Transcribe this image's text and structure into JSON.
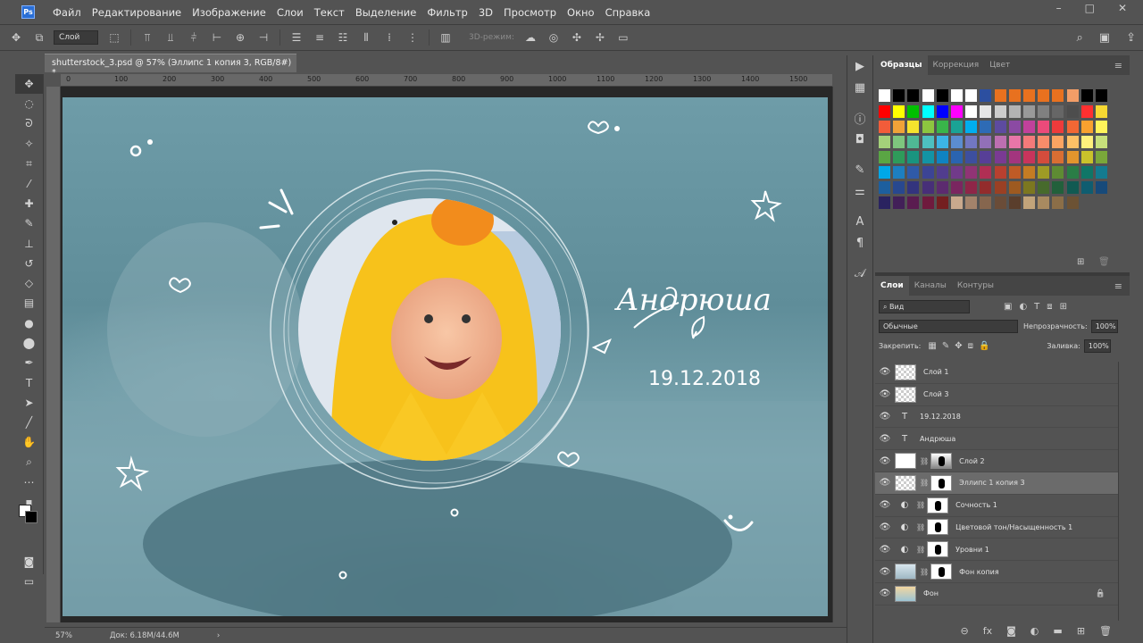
{
  "app": {
    "logo": "Ps"
  },
  "menu": [
    "Файл",
    "Редактирование",
    "Изображение",
    "Слои",
    "Текст",
    "Выделение",
    "Фильтр",
    "3D",
    "Просмотр",
    "Окно",
    "Справка"
  ],
  "window_controls": [
    "–",
    "□",
    "✕"
  ],
  "options": {
    "sample_select": "Слой",
    "mode_3d": "3D-режим:"
  },
  "document": {
    "tab_title": "shutterstock_3.psd @ 57% (Эллипс 1 копия 3, RGB/8#) *",
    "zoom": "57%",
    "doc_size": "Док: 6.18M/44.6M"
  },
  "ruler_h": [
    "0",
    "100",
    "200",
    "300",
    "400",
    "500",
    "600",
    "700",
    "800",
    "900",
    "1000",
    "1100",
    "1200",
    "1300",
    "1400",
    "1500"
  ],
  "artwork": {
    "name": "Андрюша",
    "date": "19.12.2018"
  },
  "right_panel": {
    "tabs": [
      "Образцы",
      "Коррекция",
      "Цвет"
    ],
    "swatch_colors": {
      "row1": [
        "#ffffff",
        "#000000",
        "#000000",
        "#ffffff",
        "#000000",
        "#ffffff",
        "#ffffff",
        "#2c4fa0",
        "#e8711f",
        "#e8711f",
        "#e8711f",
        "#e8711f",
        "#e8711f",
        "#f39d67",
        "#000000",
        "#000000"
      ],
      "row2": [
        "#ff0000",
        "#ffff00",
        "#00c000",
        "#00ffff",
        "#0000ff",
        "#ff00ff",
        "#ffffff",
        "#e6e6e6",
        "#cccccc",
        "#b3b3b3",
        "#999999",
        "#808080",
        "#666666",
        "#4d4d4d",
        "#ff3030",
        "#f7d832"
      ],
      "row3": [
        "#f25c3a",
        "#f0a238",
        "#f5e32d",
        "#8dc63f",
        "#39b54a",
        "#1aa395",
        "#00aeef",
        "#2e6bb5",
        "#5d4ba0",
        "#8b4aa3",
        "#c1419b",
        "#ec4a7a",
        "#ed3b3b",
        "#f26734",
        "#f9a12f",
        "#fff45a"
      ],
      "row4": [
        "#a4d17a",
        "#7ec67e",
        "#4fb995",
        "#4dc0c0",
        "#3cb4e6",
        "#5b8dd0",
        "#7277c2",
        "#9270b8",
        "#bd6fb1",
        "#e876a8",
        "#f47a7a",
        "#f88c6a",
        "#fba462",
        "#fdc066",
        "#fff07c",
        "#c7e07b"
      ],
      "row5": [
        "#5aa644",
        "#2e9b5a",
        "#19947f",
        "#1394a5",
        "#0f83c2",
        "#2a64b0",
        "#3d4f9f",
        "#573f97",
        "#7a3a93",
        "#a3357e",
        "#c8345c",
        "#d44c3c",
        "#d86e33",
        "#e2952d",
        "#c9c22b",
        "#7aa73a"
      ],
      "row6": [
        "#00a8e8",
        "#1d7fc0",
        "#2f5aa8",
        "#3c4495",
        "#513d8e",
        "#713a8a",
        "#903475",
        "#b02f54",
        "#b8402f",
        "#bf5b26",
        "#c47c23",
        "#9f9b25",
        "#5e8b33",
        "#2a7d46",
        "#0f7667",
        "#137b90"
      ],
      "row7": [
        "#1d5f9e",
        "#28488f",
        "#33347e",
        "#472f78",
        "#5c2b6f",
        "#7a2660",
        "#8e2648",
        "#932c2c",
        "#9a4024",
        "#9e5a20",
        "#7c7720",
        "#476a2c",
        "#22603b",
        "#115a52",
        "#0f5d70",
        "#174a7a"
      ],
      "row8": [
        "#2a2360",
        "#422058",
        "#5a1c50",
        "#6f1a3d",
        "#741f20",
        "#c9a98d",
        "#a3836b",
        "#86664e",
        "#6a4c38",
        "#5a3e2c",
        "#c2a47a",
        "#a88a60",
        "#8b6e48",
        "#6c5234"
      ]
    },
    "layers_tabs": [
      "Слои",
      "Каналы",
      "Контуры"
    ],
    "kind_select": "Вид",
    "blend_mode": "Обычные",
    "opacity_label": "Непрозрачность:",
    "opacity_value": "100%",
    "lock_label": "Закрепить:",
    "fill_label": "Заливка:",
    "fill_value": "100%",
    "layers": [
      {
        "name": "Слой 1",
        "kind": "pixel"
      },
      {
        "name": "Слой 3",
        "kind": "pixel"
      },
      {
        "name": "19.12.2018",
        "kind": "text"
      },
      {
        "name": "Андрюша",
        "kind": "text"
      },
      {
        "name": "Слой 2",
        "kind": "masked"
      },
      {
        "name": "Эллипс 1 копия 3",
        "kind": "shape",
        "selected": true
      },
      {
        "name": "Сочность 1",
        "kind": "adjust"
      },
      {
        "name": "Цветовой тон/Насыщенность 1",
        "kind": "adjust"
      },
      {
        "name": "Уровни 1",
        "kind": "adjust"
      },
      {
        "name": "Фон копия",
        "kind": "photo"
      },
      {
        "name": "Фон",
        "kind": "bg"
      }
    ]
  }
}
